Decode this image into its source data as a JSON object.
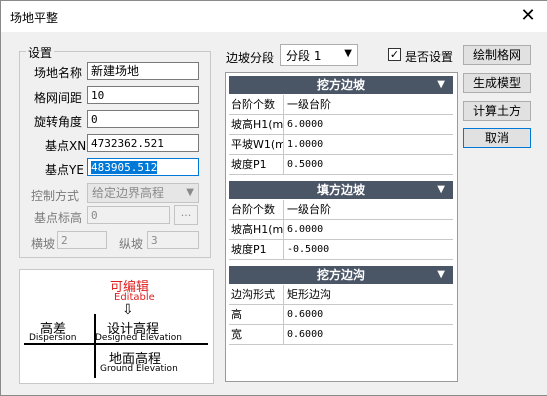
{
  "window": {
    "title": "场地平整",
    "close_icon": "close-icon"
  },
  "settings": {
    "group_title": "设置",
    "site_name": {
      "label": "场地名称",
      "value": "新建场地"
    },
    "grid_spacing": {
      "label": "格网间距",
      "value": "10"
    },
    "rotation": {
      "label": "旋转角度",
      "value": "0"
    },
    "base_xn": {
      "label": "基点XN",
      "value": "4732362.521"
    },
    "base_ye": {
      "label": "基点YE",
      "value": "483905.512"
    },
    "control_mode": {
      "label": "控制方式",
      "value": "给定边界高程"
    },
    "base_elev": {
      "label": "基点标高",
      "value": "0",
      "button": "..."
    },
    "cross_slope": {
      "label": "横坡",
      "value": "2"
    },
    "long_slope": {
      "label": "纵坡",
      "value": "3"
    }
  },
  "diagram": {
    "editable_cn": "可编辑",
    "editable_en": "Editable",
    "dispersion_cn": "高差",
    "dispersion_en": "Dispersion",
    "designed_cn": "设计高程",
    "designed_en": "Designed Elevation",
    "ground_cn": "地面高程",
    "ground_en": "Ground Elevation",
    "arrow": "⇩"
  },
  "slope_segment": {
    "label": "边坡分段",
    "value": "分段 1"
  },
  "is_set": {
    "label": "是否设置",
    "checked": true
  },
  "sections": [
    {
      "title": "挖方边坡",
      "rows": [
        {
          "key": "台阶个数",
          "value": "一级台阶"
        },
        {
          "key": "坡高H1(m)",
          "value": "6.0000"
        },
        {
          "key": "平坡W1(m)",
          "value": "1.0000"
        },
        {
          "key": "坡度P1",
          "value": "0.5000"
        }
      ]
    },
    {
      "title": "填方边坡",
      "rows": [
        {
          "key": "台阶个数",
          "value": "一级台阶"
        },
        {
          "key": "坡高H1(m)",
          "value": "6.0000"
        },
        {
          "key": "坡度P1",
          "value": "-0.5000"
        }
      ]
    },
    {
      "title": "挖方边沟",
      "rows": [
        {
          "key": "边沟形式",
          "value": "矩形边沟"
        },
        {
          "key": "高",
          "value": "0.6000"
        },
        {
          "key": "宽",
          "value": "0.6000"
        }
      ]
    }
  ],
  "buttons": {
    "draw_grid": "绘制格网",
    "gen_model": "生成模型",
    "calc_earth": "计算土方",
    "cancel": "取消"
  }
}
